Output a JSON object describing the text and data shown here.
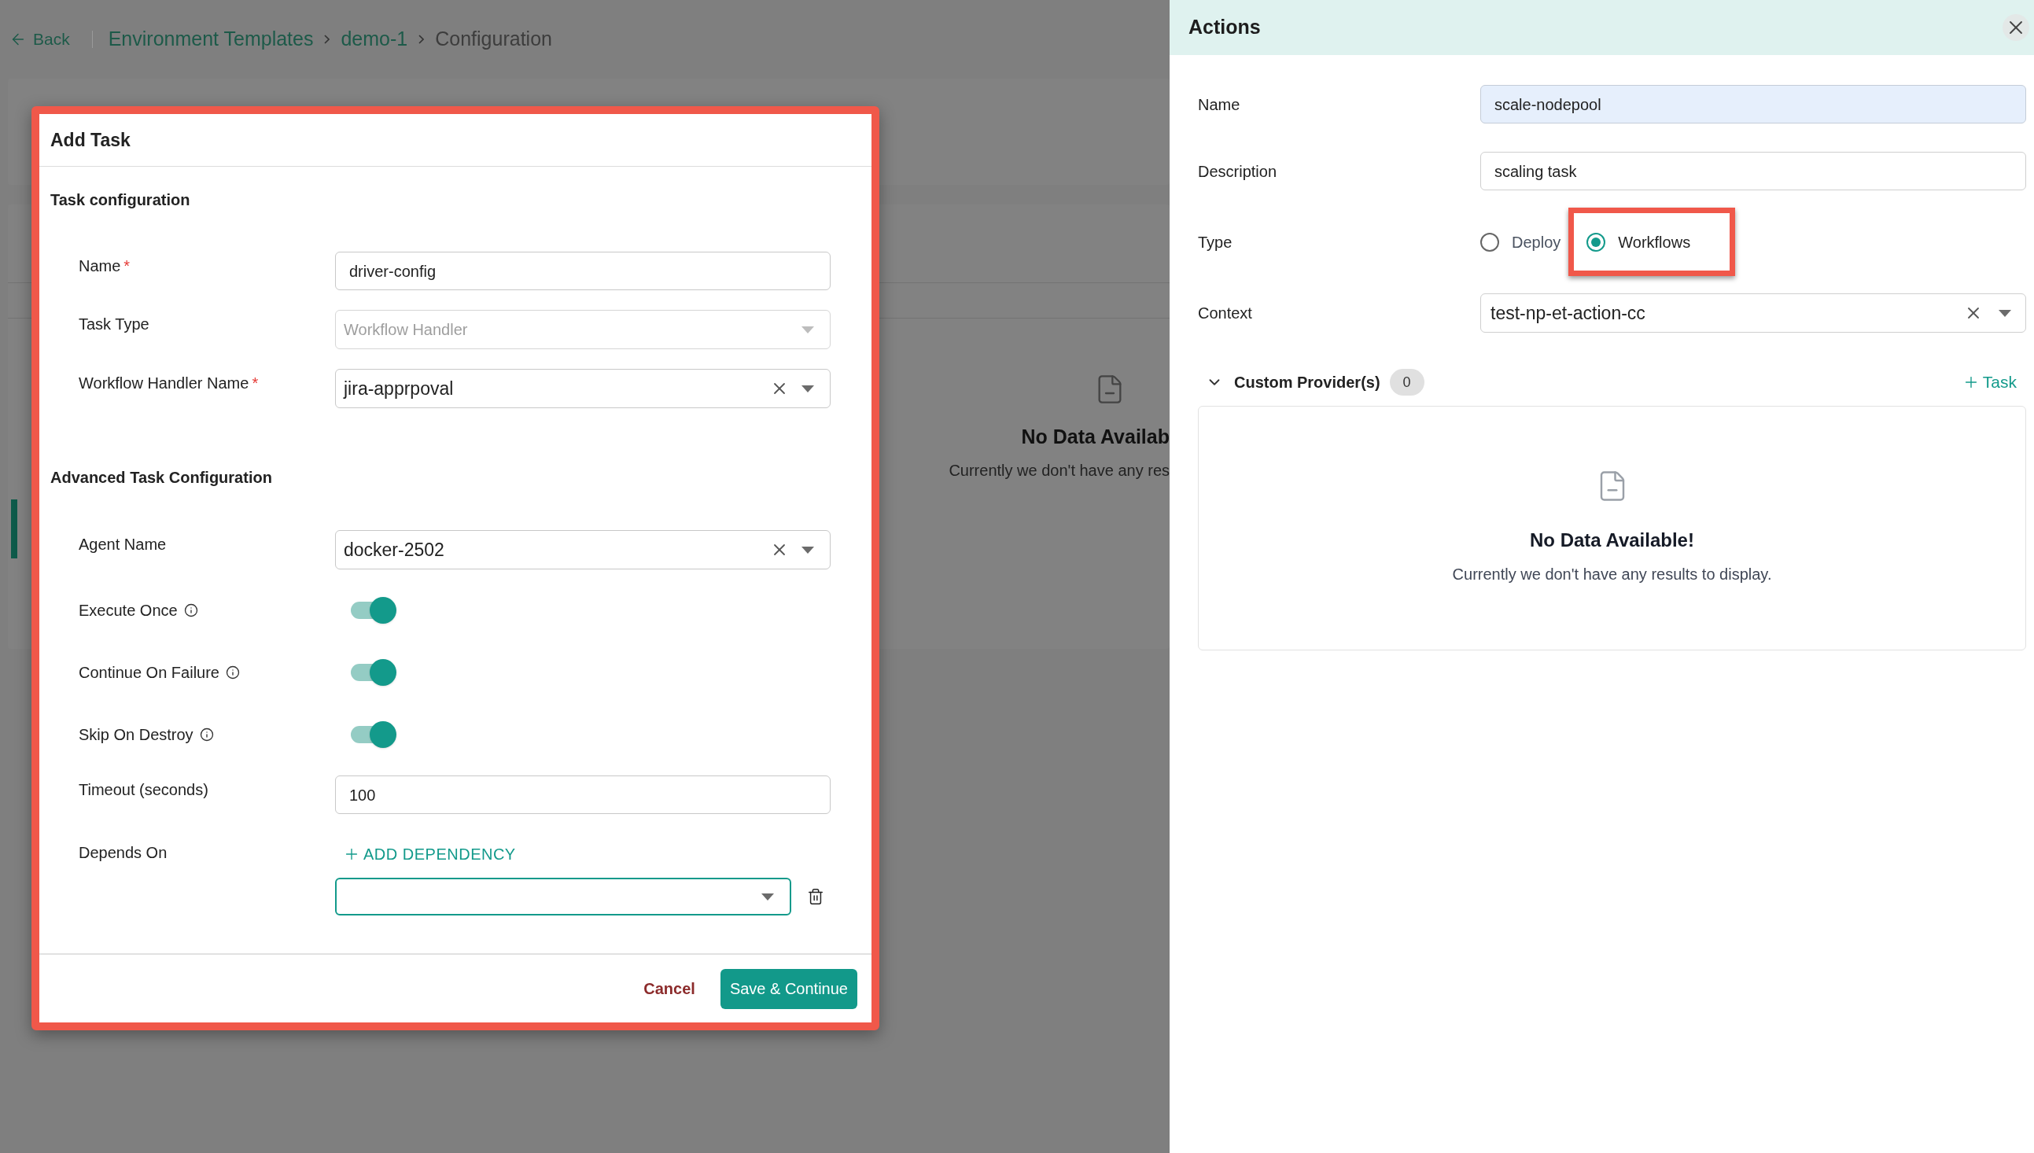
{
  "background_page": {
    "back_link": "Back",
    "breadcrumb": [
      {
        "label": "Environment Templates",
        "current": false
      },
      {
        "label": "demo-1",
        "current": false
      },
      {
        "label": "Configuration",
        "current": true
      }
    ],
    "empty_state": {
      "title": "No Data Availab",
      "message": "Currently we don't have any res"
    }
  },
  "add_task_dialog": {
    "title": "Add Task",
    "highlighted": true,
    "sections": [
      {
        "heading": "Task configuration",
        "fields": [
          {
            "kind": "text",
            "label": "Name",
            "required_mark": "*",
            "value": "driver-config"
          },
          {
            "kind": "select",
            "label": "Task Type",
            "value": "Workflow Handler",
            "disabled": true
          },
          {
            "kind": "select",
            "label": "Workflow Handler Name",
            "required_mark": "*",
            "value": "jira-apprpoval",
            "disabled": false,
            "clearable": true
          }
        ]
      },
      {
        "heading": "Advanced Task Configuration",
        "fields": [
          {
            "kind": "select",
            "label": "Agent Name",
            "value": "docker-2502",
            "disabled": false,
            "clearable": true
          },
          {
            "kind": "toggle",
            "label": "Execute Once",
            "info": true,
            "on": true
          },
          {
            "kind": "toggle",
            "label": "Continue On Failure",
            "info": true,
            "on": true
          },
          {
            "kind": "toggle",
            "label": "Skip On Destroy",
            "info": true,
            "on": true
          },
          {
            "kind": "text",
            "label": "Timeout (seconds)",
            "value": "100"
          },
          {
            "kind": "dependency",
            "label": "Depends On",
            "add_label": "ADD DEPENDENCY",
            "focused": true
          }
        ]
      }
    ],
    "cancel": "Cancel",
    "save": "Save & Continue"
  },
  "actions_panel": {
    "title": "Actions",
    "fields": [
      {
        "kind": "text",
        "label": "Name",
        "value": "scale-nodepool",
        "autofilled": true
      },
      {
        "kind": "text",
        "label": "Description",
        "value": "scaling task",
        "autofilled": false
      },
      {
        "kind": "radio",
        "label": "Type",
        "options": [
          {
            "label": "Deploy",
            "selected": false,
            "highlighted": false
          },
          {
            "label": "Workflows",
            "selected": true,
            "highlighted": true
          }
        ]
      },
      {
        "kind": "select",
        "label": "Context",
        "value": "test-np-et-action-cc",
        "clearable": true
      }
    ],
    "providers": {
      "label": "Custom Provider(s)",
      "count": "0",
      "expanded": true,
      "add_label": "Task"
    },
    "empty_state": {
      "title": "No Data Available!",
      "message": "Currently we don't have any results to display."
    }
  }
}
